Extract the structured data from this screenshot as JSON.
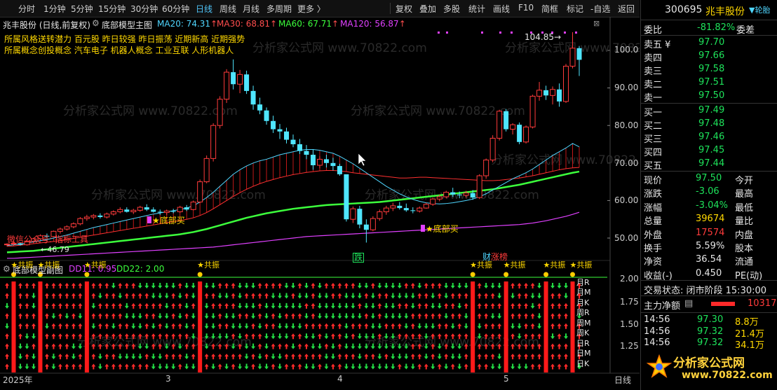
{
  "toolbar": {
    "periods": [
      "分时",
      "1分钟",
      "5分钟",
      "15分钟",
      "30分钟",
      "60分钟",
      "日线",
      "周线",
      "月线",
      "多周期",
      "更多 〉"
    ],
    "active_period": "日线",
    "actions": [
      "复权",
      "叠加",
      "多股",
      "统计",
      "画线",
      "F10",
      "简框",
      "标记",
      "-自选",
      "返回"
    ]
  },
  "main": {
    "stock_title": "兆丰股份 (日线,前复权)",
    "indicator_name": "底部模型主图",
    "ma": [
      {
        "label": "MA20: 74.31",
        "arrow": "↑",
        "color": "#4fd6ff"
      },
      {
        "label": "MA30: 68.81",
        "arrow": "↑",
        "color": "#ff4d4d"
      },
      {
        "label": "MA60: 67.71",
        "arrow": "↑",
        "color": "#3cff3c"
      },
      {
        "label": "MA120: 56.87",
        "arrow": "↑",
        "color": "#e040ff"
      }
    ],
    "style_line": "所属风格送转潜力 百元股 昨日较强 昨日振荡 近期新高 近期强势",
    "concept_line": "所属概念创投概念 汽车电子 机器人概念 工业互联 人形机器人",
    "high_label": "104.85",
    "low_label": "46.79",
    "wechat_label": "微信公众号: 指标工具",
    "bottom_buy_1": "★底部买",
    "bottom_buy_2": "★底部买",
    "tag_fall": "跌",
    "tag_fin": "财",
    "tag_rank": "涨榜",
    "y_ticks": [
      "100.0",
      "90.00",
      "80.00",
      "70.00",
      "60.00",
      "50.00"
    ],
    "watermark": "分析家公式网 www.70822.com"
  },
  "sub": {
    "indicator_name": "底部模型副图",
    "dd11": "DD11: 0.95",
    "dd22": "DD22: 2.00",
    "y_ticks": [
      "2.00",
      "1.75",
      "1.50",
      "1.25"
    ],
    "gongzhen": "★共振",
    "row_labels": [
      "月R",
      "月M",
      "月K",
      "周R",
      "周M",
      "周K",
      "日R",
      "日M",
      "日K"
    ]
  },
  "x_axis": {
    "labels": [
      "2025年",
      "3",
      "4",
      "5"
    ],
    "period": "日线"
  },
  "panel": {
    "code": "300695",
    "name": "兆丰股份",
    "corner": "▼轮胎",
    "weibi_label": "委比",
    "weibi_value": "-81.82%",
    "weicha_label": "委差",
    "sell": [
      {
        "label": "卖五 ¥",
        "price": "97.70"
      },
      {
        "label": "卖四",
        "price": "97.66"
      },
      {
        "label": "卖三",
        "price": "97.58"
      },
      {
        "label": "卖二",
        "price": "97.51"
      },
      {
        "label": "卖一",
        "price": "97.50"
      }
    ],
    "buy": [
      {
        "label": "买一",
        "price": "97.49"
      },
      {
        "label": "买二",
        "price": "97.48"
      },
      {
        "label": "买三",
        "price": "97.46"
      },
      {
        "label": "买四",
        "price": "97.45"
      },
      {
        "label": "买五",
        "price": "97.44"
      }
    ],
    "stats": [
      {
        "l1": "现价",
        "v1": "97.50",
        "c1": "green",
        "l2": "今开"
      },
      {
        "l1": "涨跌",
        "v1": "-3.06",
        "c1": "green",
        "l2": "最高"
      },
      {
        "l1": "涨幅",
        "v1": "-3.04%",
        "c1": "green",
        "l2": "最低"
      },
      {
        "l1": "总量",
        "v1": "39674",
        "c1": "yellow",
        "l2": "量比"
      },
      {
        "l1": "外盘",
        "v1": "17574",
        "c1": "red",
        "l2": "内盘"
      },
      {
        "l1": "换手",
        "v1": "5.59%",
        "c1": "white",
        "l2": "股本"
      },
      {
        "l1": "净资",
        "v1": "36.54",
        "c1": "white",
        "l2": "流通"
      },
      {
        "l1": "收益(-)",
        "v1": "0.450",
        "c1": "white",
        "l2": "PE(动)"
      }
    ],
    "trade_status": "交易状态: 闭市阶段 15:30:00",
    "main_flow_label": "主力净额",
    "main_flow_value": "10317",
    "ticks": [
      {
        "time": "14:56",
        "price": "97.30",
        "vol": "8.8万"
      },
      {
        "time": "14:56",
        "price": "97.32",
        "vol": "21.4万"
      },
      {
        "time": "14:56",
        "price": "97.32",
        "vol": "34.1万"
      }
    ],
    "logo_text": "分析家公式网",
    "logo_url": "www.70822.com"
  },
  "chart_data": {
    "type": "candlestick",
    "y_range": [
      45,
      108
    ],
    "candles": [
      [
        48.2,
        48.6,
        47.8,
        48.4
      ],
      [
        48.4,
        49.0,
        47.9,
        48.6
      ],
      [
        48.6,
        48.9,
        48.0,
        48.2
      ],
      [
        48.2,
        49.4,
        48.0,
        49.2
      ],
      [
        49.2,
        50.0,
        48.8,
        49.8
      ],
      [
        49.8,
        51.0,
        49.4,
        50.6
      ],
      [
        50.6,
        51.2,
        50.0,
        50.4
      ],
      [
        50.4,
        52.0,
        50.2,
        51.8
      ],
      [
        51.8,
        52.8,
        51.2,
        52.4
      ],
      [
        52.4,
        53.4,
        52.0,
        53.0
      ],
      [
        53.0,
        54.2,
        52.6,
        53.8
      ],
      [
        53.8,
        55.6,
        53.4,
        55.2
      ],
      [
        55.2,
        56.2,
        54.6,
        55.6
      ],
      [
        55.6,
        56.4,
        55.0,
        56.0
      ],
      [
        56.0,
        56.6,
        55.2,
        55.6
      ],
      [
        55.6,
        56.8,
        55.2,
        56.4
      ],
      [
        56.4,
        57.4,
        56.0,
        57.0
      ],
      [
        57.0,
        58.2,
        56.6,
        57.6
      ],
      [
        57.6,
        58.2,
        56.8,
        57.0
      ],
      [
        57.0,
        57.8,
        56.4,
        57.4
      ],
      [
        57.4,
        58.6,
        57.0,
        58.2
      ],
      [
        58.2,
        59.0,
        57.2,
        57.6
      ],
      [
        57.6,
        58.2,
        56.8,
        57.0
      ],
      [
        57.0,
        57.6,
        56.2,
        56.8
      ],
      [
        56.8,
        57.6,
        56.2,
        57.2
      ],
      [
        57.2,
        57.8,
        56.6,
        57.0
      ],
      [
        57.0,
        58.6,
        56.8,
        58.2
      ],
      [
        58.2,
        58.8,
        57.2,
        57.6
      ],
      [
        57.6,
        60.0,
        57.4,
        59.6
      ],
      [
        59.6,
        65.6,
        59.4,
        65.0
      ],
      [
        65.0,
        72.0,
        64.6,
        71.2
      ],
      [
        71.2,
        80.6,
        70.4,
        80.0
      ],
      [
        80.0,
        87.8,
        79.2,
        87.0
      ],
      [
        87.0,
        95.0,
        86.0,
        94.2
      ],
      [
        94.2,
        97.6,
        89.6,
        91.0
      ],
      [
        91.0,
        94.8,
        88.6,
        93.6
      ],
      [
        93.6,
        94.6,
        88.4,
        89.2
      ],
      [
        89.2,
        90.6,
        84.2,
        85.6
      ],
      [
        85.6,
        87.4,
        83.0,
        84.0
      ],
      [
        84.0,
        84.8,
        80.2,
        81.2
      ],
      [
        81.2,
        82.6,
        78.0,
        79.0
      ],
      [
        79.0,
        80.4,
        76.4,
        78.4
      ],
      [
        78.4,
        79.4,
        75.2,
        76.2
      ],
      [
        76.2,
        77.6,
        74.2,
        75.0
      ],
      [
        75.0,
        76.4,
        72.4,
        73.2
      ],
      [
        73.2,
        74.8,
        71.0,
        72.2
      ],
      [
        72.2,
        73.6,
        68.2,
        69.4
      ],
      [
        69.4,
        71.8,
        68.6,
        71.0
      ],
      [
        71.0,
        72.2,
        68.8,
        70.0
      ],
      [
        70.0,
        71.4,
        68.0,
        69.2
      ],
      [
        69.2,
        69.8,
        66.6,
        67.0
      ],
      [
        67.0,
        62.4,
        54.4,
        55.0
      ],
      [
        55.0,
        58.4,
        54.0,
        57.8
      ],
      [
        57.8,
        58.6,
        52.6,
        53.6
      ],
      [
        53.6,
        55.0,
        48.8,
        52.2
      ],
      [
        52.2,
        55.8,
        51.8,
        55.2
      ],
      [
        55.2,
        57.6,
        54.6,
        57.0
      ],
      [
        57.0,
        58.6,
        56.2,
        58.0
      ],
      [
        58.0,
        59.4,
        57.2,
        58.6
      ],
      [
        58.6,
        59.6,
        57.6,
        58.0
      ],
      [
        58.0,
        59.2,
        57.0,
        57.4
      ],
      [
        57.4,
        58.2,
        56.6,
        57.2
      ],
      [
        57.2,
        58.4,
        56.8,
        58.0
      ],
      [
        58.0,
        59.4,
        57.8,
        59.0
      ],
      [
        59.0,
        60.8,
        58.6,
        60.4
      ],
      [
        60.4,
        61.6,
        59.8,
        61.0
      ],
      [
        61.0,
        62.6,
        60.6,
        62.2
      ],
      [
        62.2,
        63.4,
        61.0,
        61.6
      ],
      [
        61.6,
        62.4,
        60.6,
        61.4
      ],
      [
        61.4,
        62.6,
        60.8,
        62.0
      ],
      [
        62.0,
        62.8,
        60.2,
        60.8
      ],
      [
        60.8,
        67.0,
        60.4,
        66.6
      ],
      [
        66.6,
        71.2,
        65.8,
        70.8
      ],
      [
        70.8,
        77.4,
        70.2,
        76.6
      ],
      [
        76.6,
        84.2,
        76.0,
        83.8
      ],
      [
        83.8,
        84.4,
        78.4,
        79.0
      ],
      [
        79.0,
        80.6,
        77.6,
        80.2
      ],
      [
        80.2,
        80.8,
        75.0,
        75.6
      ],
      [
        75.6,
        80.0,
        75.2,
        79.6
      ],
      [
        79.6,
        88.2,
        79.2,
        87.8
      ],
      [
        87.8,
        91.6,
        86.6,
        89.4
      ],
      [
        89.4,
        90.6,
        86.8,
        88.0
      ],
      [
        88.0,
        90.4,
        85.6,
        89.6
      ],
      [
        89.6,
        91.2,
        85.0,
        86.4
      ],
      [
        86.4,
        96.4,
        86.0,
        95.8
      ],
      [
        95.8,
        104.85,
        95.2,
        100.6
      ],
      [
        100.6,
        101.2,
        93.2,
        97.5
      ]
    ],
    "ma20": [
      48.0,
      48.2,
      48.4,
      48.7,
      49.0,
      49.3,
      49.6,
      50.0,
      50.4,
      50.8,
      51.3,
      51.8,
      52.3,
      52.8,
      53.2,
      53.6,
      54.0,
      54.4,
      54.8,
      55.2,
      55.6,
      56.0,
      56.4,
      56.7,
      57.0,
      57.3,
      57.6,
      58.0,
      58.6,
      59.6,
      60.8,
      62.2,
      63.8,
      65.4,
      67.0,
      68.2,
      69.2,
      70.0,
      70.6,
      71.0,
      71.6,
      72.2,
      72.6,
      73.0,
      73.4,
      73.6,
      73.6,
      73.4,
      73.0,
      72.6,
      71.8,
      70.8,
      69.8,
      68.6,
      67.4,
      66.2,
      65.0,
      63.8,
      62.8,
      61.8,
      61.0,
      60.3,
      59.8,
      59.4,
      59.2,
      59.1,
      59.2,
      59.4,
      59.7,
      60.0,
      60.4,
      61.0,
      61.8,
      62.8,
      63.8,
      64.8,
      65.8,
      66.6,
      67.4,
      68.4,
      69.6,
      70.8,
      72.0,
      73.0,
      74.0,
      75.2,
      74.31
    ],
    "ma30": [
      47.8,
      47.9,
      48.1,
      48.3,
      48.5,
      48.7,
      48.9,
      49.1,
      49.3,
      49.6,
      49.9,
      50.2,
      50.5,
      50.8,
      51.1,
      51.4,
      51.7,
      52.0,
      52.3,
      52.6,
      52.9,
      53.2,
      53.5,
      53.8,
      54.1,
      54.4,
      54.7,
      55.0,
      55.4,
      56.0,
      56.8,
      57.8,
      58.9,
      60.0,
      61.1,
      62.1,
      63.0,
      63.8,
      64.5,
      65.1,
      65.6,
      66.1,
      66.5,
      66.9,
      67.2,
      67.5,
      67.7,
      67.9,
      68.0,
      68.0,
      67.9,
      67.7,
      67.4,
      67.2,
      67.0,
      66.8,
      66.6,
      66.4,
      66.2,
      66.0,
      66.0,
      66.1,
      66.2,
      66.2,
      66.1,
      66.0,
      65.9,
      65.8,
      65.7,
      65.6,
      65.5,
      65.4,
      65.3,
      65.3,
      65.4,
      65.6,
      65.8,
      66.0,
      66.3,
      66.6,
      67.0,
      67.4,
      67.8,
      68.2,
      68.5,
      68.7,
      68.81
    ],
    "ma60": [
      46.2,
      46.3,
      46.4,
      46.5,
      46.6,
      46.8,
      47.0,
      47.2,
      47.4,
      47.6,
      47.8,
      48.0,
      48.2,
      48.4,
      48.6,
      48.8,
      49.0,
      49.2,
      49.4,
      49.6,
      49.8,
      50.0,
      50.2,
      50.4,
      50.6,
      50.8,
      51.0,
      51.3,
      51.6,
      52.0,
      52.4,
      52.9,
      53.4,
      53.9,
      54.4,
      54.9,
      55.4,
      55.8,
      56.2,
      56.6,
      56.9,
      57.2,
      57.5,
      57.8,
      58.0,
      58.2,
      58.4,
      58.6,
      58.8,
      58.9,
      59.0,
      59.1,
      59.2,
      59.3,
      59.4,
      59.5,
      59.6,
      59.8,
      60.0,
      60.2,
      60.4,
      60.6,
      60.8,
      61.0,
      61.2,
      61.4,
      61.6,
      61.8,
      62.0,
      62.2,
      62.4,
      62.6,
      62.8,
      63.0,
      63.3,
      63.6,
      63.9,
      64.2,
      64.6,
      65.0,
      65.4,
      65.8,
      66.2,
      66.6,
      67.0,
      67.4,
      67.71
    ],
    "ma120": [
      44.6,
      44.6,
      44.7,
      44.8,
      44.9,
      45.0,
      45.1,
      45.2,
      45.3,
      45.4,
      45.5,
      45.6,
      45.7,
      45.8,
      45.9,
      46.0,
      46.1,
      46.2,
      46.3,
      46.4,
      46.5,
      46.6,
      46.7,
      46.8,
      46.9,
      47.0,
      47.1,
      47.2,
      47.3,
      47.4,
      47.5,
      47.6,
      47.8,
      48.0,
      48.2,
      48.4,
      48.6,
      48.8,
      49.0,
      49.2,
      49.4,
      49.6,
      49.8,
      50.0,
      50.2,
      50.4,
      50.5,
      50.6,
      50.7,
      50.8,
      50.9,
      51.0,
      51.1,
      51.2,
      51.3,
      51.4,
      51.5,
      51.6,
      51.7,
      51.8,
      51.9,
      52.0,
      52.1,
      52.2,
      52.3,
      52.4,
      52.5,
      52.6,
      52.7,
      52.8,
      52.9,
      53.0,
      53.1,
      53.2,
      53.3,
      53.4,
      53.5,
      53.6,
      53.8,
      54.0,
      54.3,
      54.6,
      55.0,
      55.4,
      55.8,
      56.3,
      56.87
    ],
    "sub_signal_cols": [
      0,
      2,
      4,
      6,
      8,
      10,
      12,
      14,
      16,
      18,
      20,
      22,
      24,
      26,
      28,
      30,
      32,
      34,
      36,
      38,
      40,
      42,
      44,
      46,
      48,
      50,
      52,
      54,
      56,
      58,
      60,
      62,
      64,
      66,
      68,
      70,
      72,
      74,
      76,
      78,
      80,
      82,
      84,
      86
    ],
    "gongzhen_cols": [
      1,
      5,
      12,
      29,
      70,
      75,
      81,
      85
    ]
  }
}
